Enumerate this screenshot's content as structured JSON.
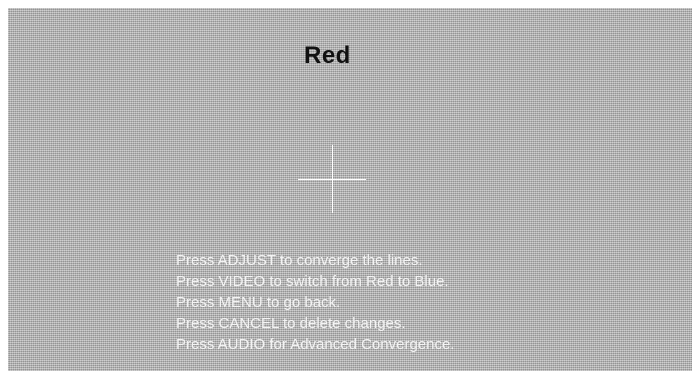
{
  "screen": {
    "title": "Red",
    "crosshair_icon": "crosshair-icon",
    "instructions": [
      "Press ADJUST to converge the lines.",
      "Press VIDEO to switch from Red to Blue.",
      "Press MENU to go back.",
      "Press CANCEL to delete changes.",
      "Press AUDIO for Advanced Convergence."
    ]
  }
}
